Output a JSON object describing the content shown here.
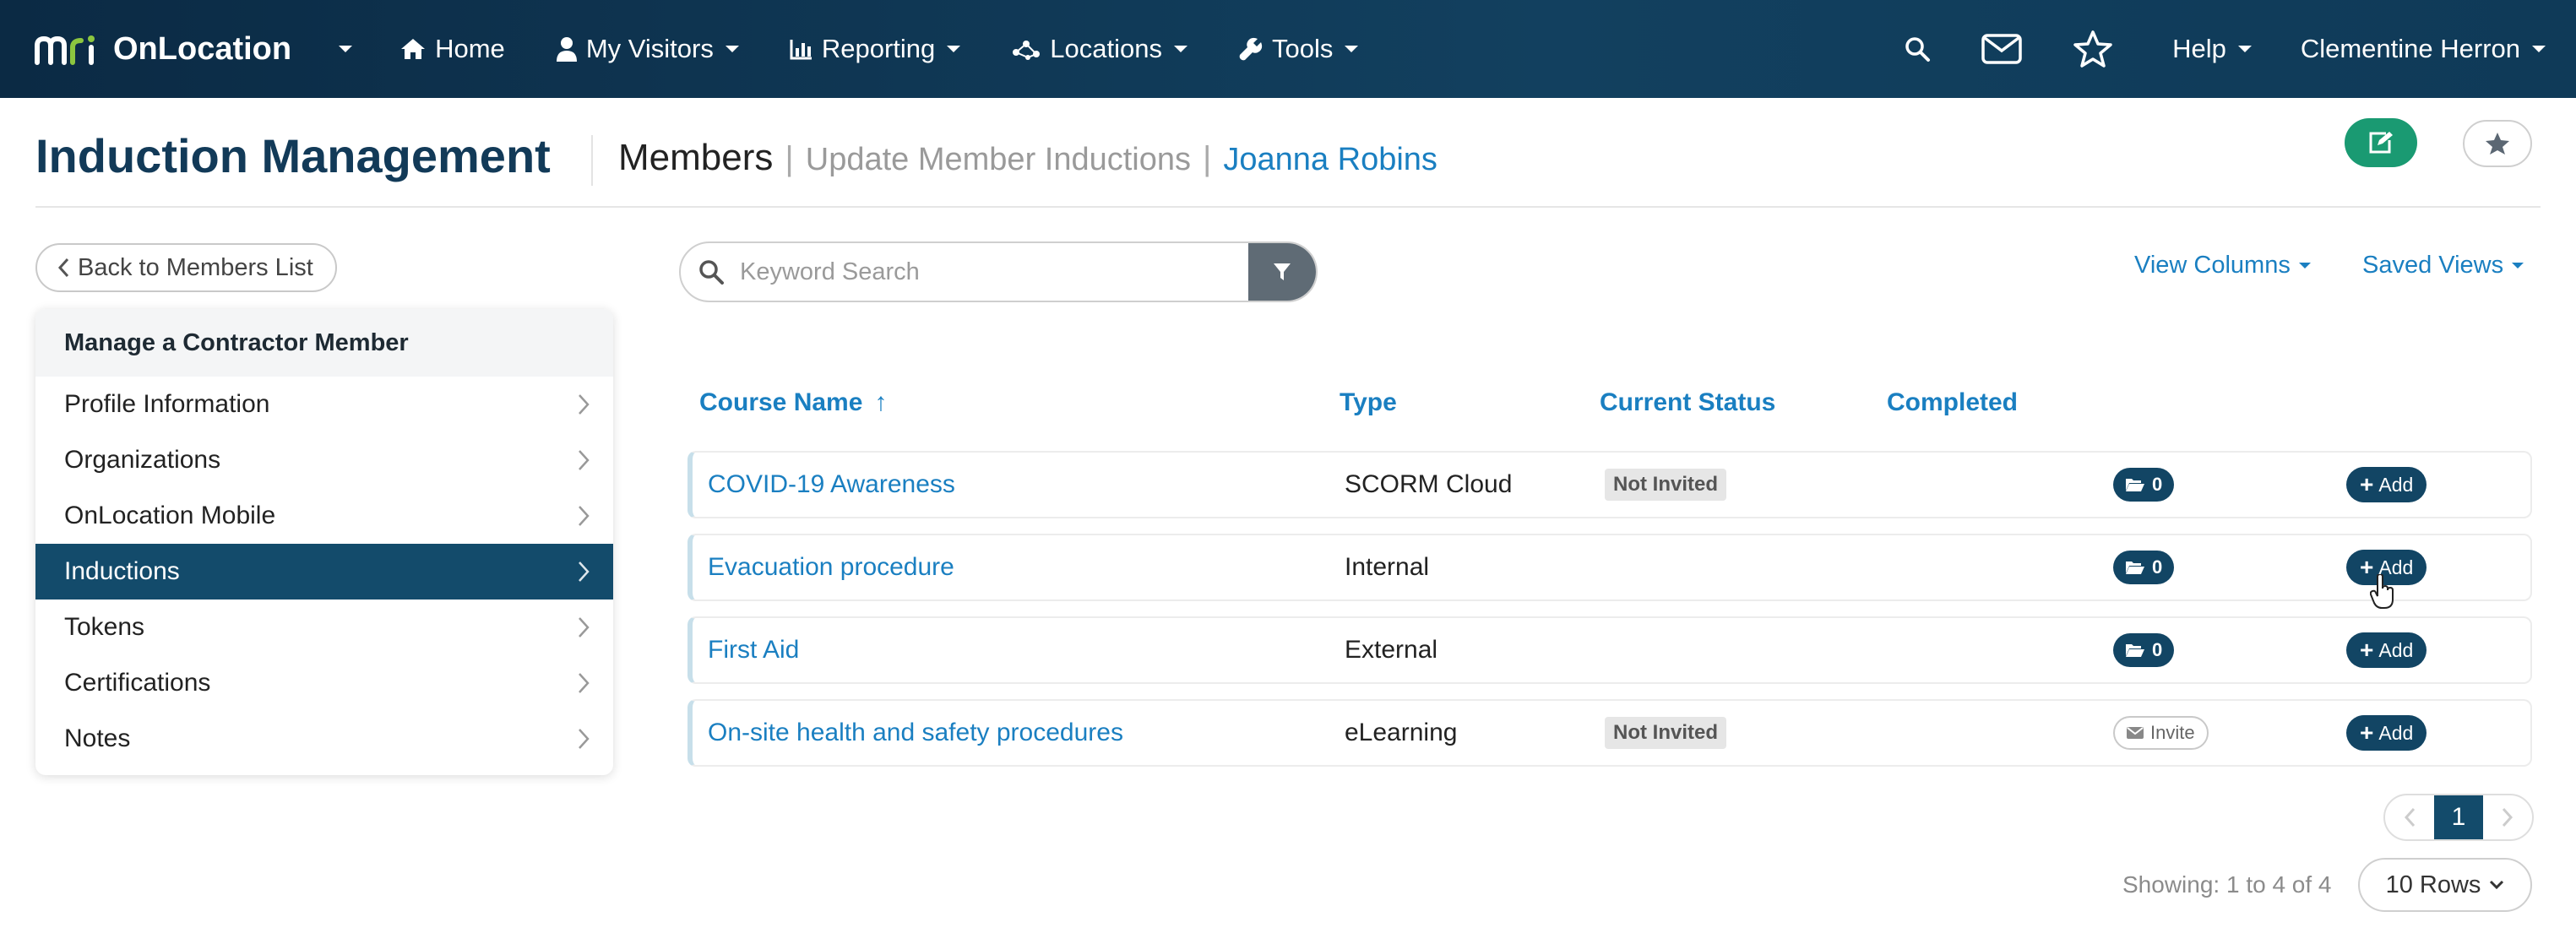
{
  "nav": {
    "brand_name": "OnLocation",
    "items": [
      {
        "label": "Home",
        "icon": "home-icon"
      },
      {
        "label": "My Visitors",
        "icon": "user-icon"
      },
      {
        "label": "Reporting",
        "icon": "bar-chart-icon"
      },
      {
        "label": "Locations",
        "icon": "network-icon"
      },
      {
        "label": "Tools",
        "icon": "wrench-icon"
      }
    ],
    "help_label": "Help",
    "user_name": "Clementine Herron"
  },
  "header": {
    "title": "Induction Management",
    "crumb_members": "Members",
    "crumb_sep": "|",
    "crumb_update": "Update Member Inductions",
    "crumb_person": "Joanna Robins"
  },
  "sidebar": {
    "back_label": "Back to Members List",
    "heading": "Manage a Contractor Member",
    "items": [
      {
        "label": "Profile Information"
      },
      {
        "label": "Organizations"
      },
      {
        "label": "OnLocation Mobile"
      },
      {
        "label": "Inductions"
      },
      {
        "label": "Tokens"
      },
      {
        "label": "Certifications"
      },
      {
        "label": "Notes"
      }
    ],
    "active_index": 3
  },
  "toolbar": {
    "search_placeholder": "Keyword Search",
    "view_columns": "View Columns",
    "saved_views": "Saved Views"
  },
  "table": {
    "columns": {
      "course": "Course Name",
      "sort_arrow": "↑",
      "type": "Type",
      "status": "Current Status",
      "completed": "Completed"
    },
    "rows": [
      {
        "course": "COVID-19 Awareness",
        "type": "SCORM Cloud",
        "status": "Not Invited",
        "docs": "0",
        "action": "Add"
      },
      {
        "course": "Evacuation procedure",
        "type": "Internal",
        "status": "",
        "docs": "0",
        "action": "Add"
      },
      {
        "course": "First Aid",
        "type": "External",
        "status": "",
        "docs": "0",
        "action": "Add"
      },
      {
        "course": "On-site health and safety procedures",
        "type": "eLearning",
        "status": "Not Invited",
        "invite": "Invite",
        "action": "Add"
      }
    ]
  },
  "pagination": {
    "current_page": "1",
    "showing": "Showing: 1 to 4 of 4",
    "rows_label": "10 Rows"
  },
  "colors": {
    "nav_bg": "#0b2a44",
    "accent_blue": "#1a7fc1",
    "dark_teal": "#134b6b",
    "edit_green": "#1a9a72",
    "logo_green": "#8cc63f"
  }
}
